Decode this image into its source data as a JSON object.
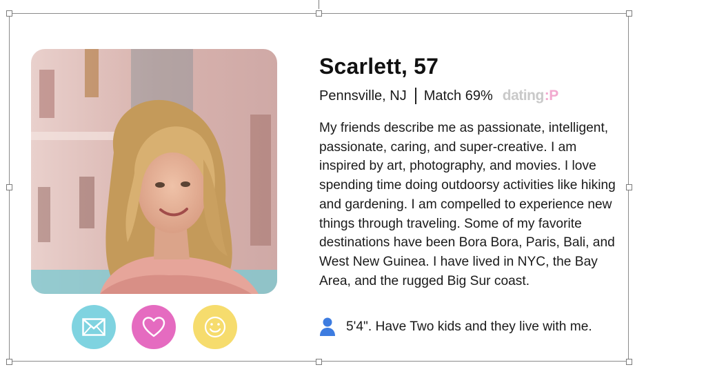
{
  "profile": {
    "name_age": "Scarlett, 57",
    "location": "Pennsville, NJ",
    "match": "Match 69%",
    "brand": {
      "text": "dating",
      "suffix": ":P"
    },
    "bio": "My friends describe me as passionate, intelligent, passionate, caring, and super-creative. I am inspired by art, photography, and movies. I love spending time doing outdoorsy activities like hiking and gardening. I am compelled to experience new things through traveling. Some of my favorite destinations have been Bora Bora, Paris, Bali, and West New Guinea. I have lived in NYC, the Bay Area, and the rugged Big Sur coast.",
    "info": "5'4\". Have Two kids and they live with me."
  },
  "actions": [
    {
      "icon": "envelope-icon",
      "color": "#7fd3e0"
    },
    {
      "icon": "heart-icon",
      "color": "#e56bc0"
    },
    {
      "icon": "smiley-icon",
      "color": "#f6dc6d"
    }
  ],
  "colors": {
    "accent_person": "#3d7ce0",
    "brand_gray": "#c9c9c9",
    "brand_pink": "#f2a9cf"
  }
}
